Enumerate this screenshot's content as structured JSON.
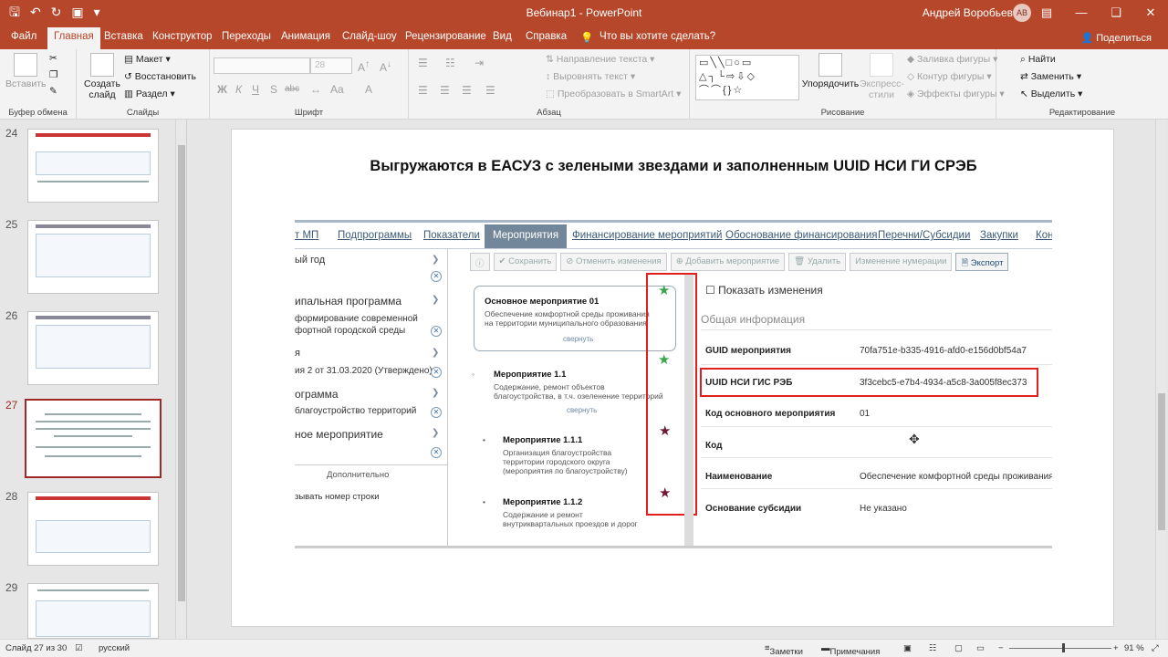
{
  "window": {
    "title": "Вебинар1 - PowerPoint",
    "user": "Андрей Воробьев",
    "user_initials": "АВ"
  },
  "tabs": [
    "Файл",
    "Главная",
    "Вставка",
    "Конструктор",
    "Переходы",
    "Анимация",
    "Слайд-шоу",
    "Рецензирование",
    "Вид",
    "Справка"
  ],
  "tell_me": "Что вы хотите сделать?",
  "share": "Поделиться",
  "ribbon": {
    "clipboard": {
      "label": "Буфер обмена",
      "paste": "Вставить"
    },
    "slides": {
      "label": "Слайды",
      "new_slide": "Создать слайд",
      "layout": "Макет",
      "reset": "Восстановить",
      "section": "Раздел"
    },
    "font": {
      "label": "Шрифт",
      "size": "28"
    },
    "paragraph": {
      "label": "Абзац",
      "direction": "Направление текста",
      "align": "Выровнять текст",
      "smartart": "Преобразовать в SmartArt"
    },
    "drawing": {
      "label": "Рисование",
      "arrange": "Упорядочить",
      "styles": "Экспресс-стили",
      "fill": "Заливка фигуры",
      "outline": "Контур фигуры",
      "effects": "Эффекты фигуры"
    },
    "editing": {
      "label": "Редактирование",
      "find": "Найти",
      "replace": "Заменить",
      "select": "Выделить"
    }
  },
  "thumbnails": [
    {
      "num": "24",
      "selected": false
    },
    {
      "num": "25",
      "selected": false
    },
    {
      "num": "26",
      "selected": false
    },
    {
      "num": "27",
      "selected": true
    },
    {
      "num": "28",
      "selected": false
    },
    {
      "num": "29",
      "selected": false
    }
  ],
  "slide": {
    "title": "Выгружаются в ЕАСУЗ с зелеными звездами и заполненным UUID НСИ ГИ СРЭБ",
    "nav": [
      "т МП",
      "Подпрограммы",
      "Показатели",
      "Мероприятия",
      "Финансирование мероприятий",
      "Обоснование финансирования",
      "Перечни/Субсидии",
      "Закупки",
      "Кон"
    ],
    "left": [
      "ый год",
      "ипальная программа",
      "формирование современной",
      "фортной городской среды",
      "я",
      "ия 2 от 31.03.2020 (Утверждено)",
      "ограмма",
      "благоустройство территорий",
      "ное мероприятие",
      "Дополнительно",
      "зывать номер строки"
    ],
    "toolbar": [
      "Сохранить",
      "Отменить изменения",
      "Добавить мероприятие",
      "Удалить",
      "Изменение нумерации",
      "Экспорт"
    ],
    "events": [
      {
        "title": "Основное мероприятие 01",
        "desc": "Обеспечение комфортной среды проживания на территории муниципального образования",
        "collapse": "свернуть",
        "star": "green"
      },
      {
        "title": "Мероприятие 1.1",
        "desc": "Содержание, ремонт объектов благоустройства, в т.ч. озеленение территорий",
        "collapse": "свернуть",
        "star": "green"
      },
      {
        "title": "Мероприятие 1.1.1",
        "desc": "Организация благоустройства территории городского округа (мероприятия по благоустройству)",
        "star": "darkred"
      },
      {
        "title": "Мероприятие 1.1.2",
        "desc": "Содержание и ремонт внутриквартальных проездов и дорог",
        "star": "darkred"
      }
    ],
    "show_changes": "Показать изменения",
    "general_info": "Общая информация",
    "fields": [
      {
        "key": "GUID мероприятия",
        "value": "70fa751e-b335-4916-afd0-e156d0bf54a7"
      },
      {
        "key": "UUID НСИ ГИС РЭБ",
        "value": "3f3cebc5-e7b4-4934-a5c8-3a005f8ec373"
      },
      {
        "key": "Код основного мероприятия",
        "value": "01"
      },
      {
        "key": "Код",
        "value": ""
      },
      {
        "key": "Наименование",
        "value": "Обеспечение комфортной среды проживания"
      },
      {
        "key": "Основание субсидии",
        "value": "Не указано"
      }
    ]
  },
  "status": {
    "slide": "Слайд 27 из 30",
    "lang": "русский",
    "notes": "Заметки",
    "comments": "Примечания",
    "zoom": "91 %"
  },
  "colors": {
    "accent": "#b7472a",
    "green_star": "#3aa64a",
    "dark_star": "#6e1a35",
    "highlight": "#e01f1f"
  }
}
